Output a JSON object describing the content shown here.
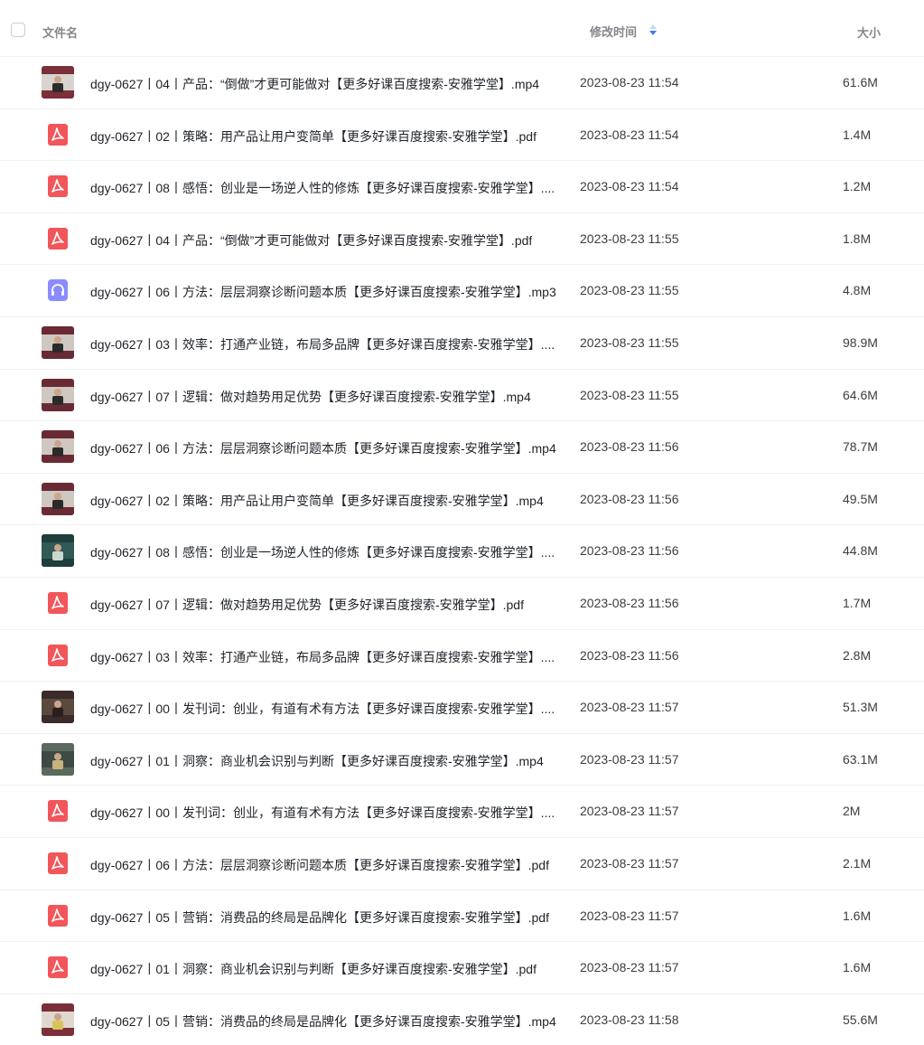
{
  "header": {
    "name_label": "文件名",
    "time_label": "修改时间",
    "size_label": "大小",
    "sort_icon": "sort-desc-icon",
    "accent_color": "#3f7cff"
  },
  "files": [
    {
      "name": "dgy-0627丨04丨产品：“倒做”才更可能做对【更多好课百度搜索-安雅学堂】.mp4",
      "time": "2023-08-23 11:54",
      "size": "61.6M",
      "type": "video",
      "thumb": "a"
    },
    {
      "name": "dgy-0627丨02丨策略：用产品让用户变简单【更多好课百度搜索-安雅学堂】.pdf",
      "time": "2023-08-23 11:54",
      "size": "1.4M",
      "type": "pdf"
    },
    {
      "name": "dgy-0627丨08丨感悟：创业是一场逆人性的修炼【更多好课百度搜索-安雅学堂】....",
      "time": "2023-08-23 11:54",
      "size": "1.2M",
      "type": "pdf"
    },
    {
      "name": "dgy-0627丨04丨产品：“倒做”才更可能做对【更多好课百度搜索-安雅学堂】.pdf",
      "time": "2023-08-23 11:55",
      "size": "1.8M",
      "type": "pdf"
    },
    {
      "name": "dgy-0627丨06丨方法：层层洞察诊断问题本质【更多好课百度搜索-安雅学堂】.mp3",
      "time": "2023-08-23 11:55",
      "size": "4.8M",
      "type": "audio"
    },
    {
      "name": "dgy-0627丨03丨效率：打通产业链，布局多品牌【更多好课百度搜索-安雅学堂】....",
      "time": "2023-08-23 11:55",
      "size": "98.9M",
      "type": "video",
      "thumb": "b"
    },
    {
      "name": "dgy-0627丨07丨逻辑：做对趋势用足优势【更多好课百度搜索-安雅学堂】.mp4",
      "time": "2023-08-23 11:55",
      "size": "64.6M",
      "type": "video",
      "thumb": "b"
    },
    {
      "name": "dgy-0627丨06丨方法：层层洞察诊断问题本质【更多好课百度搜索-安雅学堂】.mp4",
      "time": "2023-08-23 11:56",
      "size": "78.7M",
      "type": "video",
      "thumb": "b"
    },
    {
      "name": "dgy-0627丨02丨策略：用产品让用户变简单【更多好课百度搜索-安雅学堂】.mp4",
      "time": "2023-08-23 11:56",
      "size": "49.5M",
      "type": "video",
      "thumb": "b"
    },
    {
      "name": "dgy-0627丨08丨感悟：创业是一场逆人性的修炼【更多好课百度搜索-安雅学堂】....",
      "time": "2023-08-23 11:56",
      "size": "44.8M",
      "type": "video",
      "thumb": "c"
    },
    {
      "name": "dgy-0627丨07丨逻辑：做对趋势用足优势【更多好课百度搜索-安雅学堂】.pdf",
      "time": "2023-08-23 11:56",
      "size": "1.7M",
      "type": "pdf"
    },
    {
      "name": "dgy-0627丨03丨效率：打通产业链，布局多品牌【更多好课百度搜索-安雅学堂】....",
      "time": "2023-08-23 11:56",
      "size": "2.8M",
      "type": "pdf"
    },
    {
      "name": "dgy-0627丨00丨发刊词：创业，有道有术有方法【更多好课百度搜索-安雅学堂】....",
      "time": "2023-08-23 11:57",
      "size": "51.3M",
      "type": "video",
      "thumb": "d"
    },
    {
      "name": "dgy-0627丨01丨洞察：商业机会识别与判断【更多好课百度搜索-安雅学堂】.mp4",
      "time": "2023-08-23 11:57",
      "size": "63.1M",
      "type": "video",
      "thumb": "e"
    },
    {
      "name": "dgy-0627丨00丨发刊词：创业，有道有术有方法【更多好课百度搜索-安雅学堂】....",
      "time": "2023-08-23 11:57",
      "size": "2M",
      "type": "pdf"
    },
    {
      "name": "dgy-0627丨06丨方法：层层洞察诊断问题本质【更多好课百度搜索-安雅学堂】.pdf",
      "time": "2023-08-23 11:57",
      "size": "2.1M",
      "type": "pdf"
    },
    {
      "name": "dgy-0627丨05丨营销：消费品的终局是品牌化【更多好课百度搜索-安雅学堂】.pdf",
      "time": "2023-08-23 11:57",
      "size": "1.6M",
      "type": "pdf"
    },
    {
      "name": "dgy-0627丨01丨洞察：商业机会识别与判断【更多好课百度搜索-安雅学堂】.pdf",
      "time": "2023-08-23 11:57",
      "size": "1.6M",
      "type": "pdf"
    },
    {
      "name": "dgy-0627丨05丨营销：消费品的终局是品牌化【更多好课百度搜索-安雅学堂】.mp4",
      "time": "2023-08-23 11:58",
      "size": "55.6M",
      "type": "video",
      "thumb": "f"
    }
  ]
}
